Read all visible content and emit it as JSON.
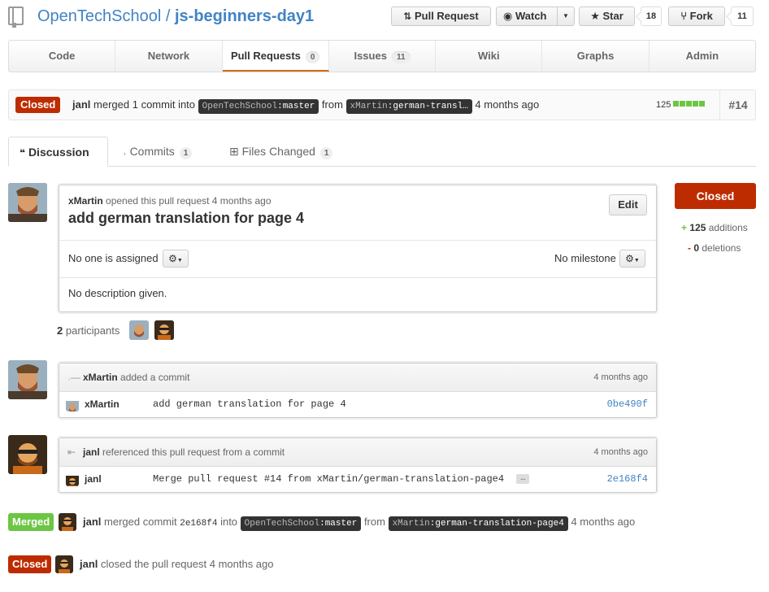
{
  "repo": {
    "owner": "OpenTechSchool",
    "separator": " / ",
    "name": "js-beginners-day1",
    "pull_request_label": "Pull Request",
    "watch_label": "Watch",
    "star_label": "Star",
    "star_count": "18",
    "fork_label": "Fork",
    "fork_count": "11"
  },
  "nav": {
    "tabs": [
      {
        "label": "Code"
      },
      {
        "label": "Network"
      },
      {
        "label": "Pull Requests",
        "count": "0"
      },
      {
        "label": "Issues",
        "count": "11"
      },
      {
        "label": "Wiki"
      },
      {
        "label": "Graphs"
      },
      {
        "label": "Admin"
      }
    ]
  },
  "summary": {
    "state": "Closed",
    "author": "janl",
    "text1": "merged 1 commit into",
    "base_owner": "OpenTechSchool",
    "base_branch": "master",
    "text2": "from",
    "head_owner": "xMartin",
    "head_branch": "german-transl…",
    "time": "4 months ago",
    "additions": "125",
    "number": "#14"
  },
  "disc_tabs": {
    "discussion": "Discussion",
    "commits": "Commits",
    "commits_count": "1",
    "files": "Files Changed",
    "files_count": "1"
  },
  "opening": {
    "author": "xMartin",
    "meta_text": "opened this pull request 4 months ago",
    "title": "add german translation for page 4",
    "edit_label": "Edit",
    "assignee_text": "No one is assigned",
    "milestone_text": "No milestone",
    "description": "No description given."
  },
  "participants": {
    "count": "2",
    "label": "participants"
  },
  "sidebar": {
    "state": "Closed",
    "additions_count": "125",
    "additions_label": "additions",
    "deletions_count": "0",
    "deletions_label": "deletions"
  },
  "events": {
    "commit": {
      "author": "xMartin",
      "text": "added a commit",
      "time": "4 months ago",
      "row_author": "xMartin",
      "message": "add german translation for page 4",
      "sha": "0be490f"
    },
    "reference": {
      "author": "janl",
      "text": "referenced this pull request from a commit",
      "time": "4 months ago",
      "row_author": "janl",
      "message": "Merge pull request #14 from xMartin/german-translation-page4",
      "ellipsis": "…",
      "sha": "2e168f4"
    },
    "merged": {
      "badge": "Merged",
      "author": "janl",
      "text1": "merged commit",
      "sha": "2e168f4",
      "text2": "into",
      "base_owner": "OpenTechSchool",
      "base_branch": "master",
      "text3": "from",
      "head_owner": "xMartin",
      "head_branch": "german-translation-page4",
      "time": "4 months ago"
    },
    "closed": {
      "badge": "Closed",
      "author": "janl",
      "text": "closed the pull request 4 months ago"
    }
  },
  "colors": {
    "link": "#4183c4",
    "closed": "#bd2c00",
    "merged": "#6cc644",
    "additions": "#6cc644",
    "active_tab_underline": "#d26911"
  }
}
